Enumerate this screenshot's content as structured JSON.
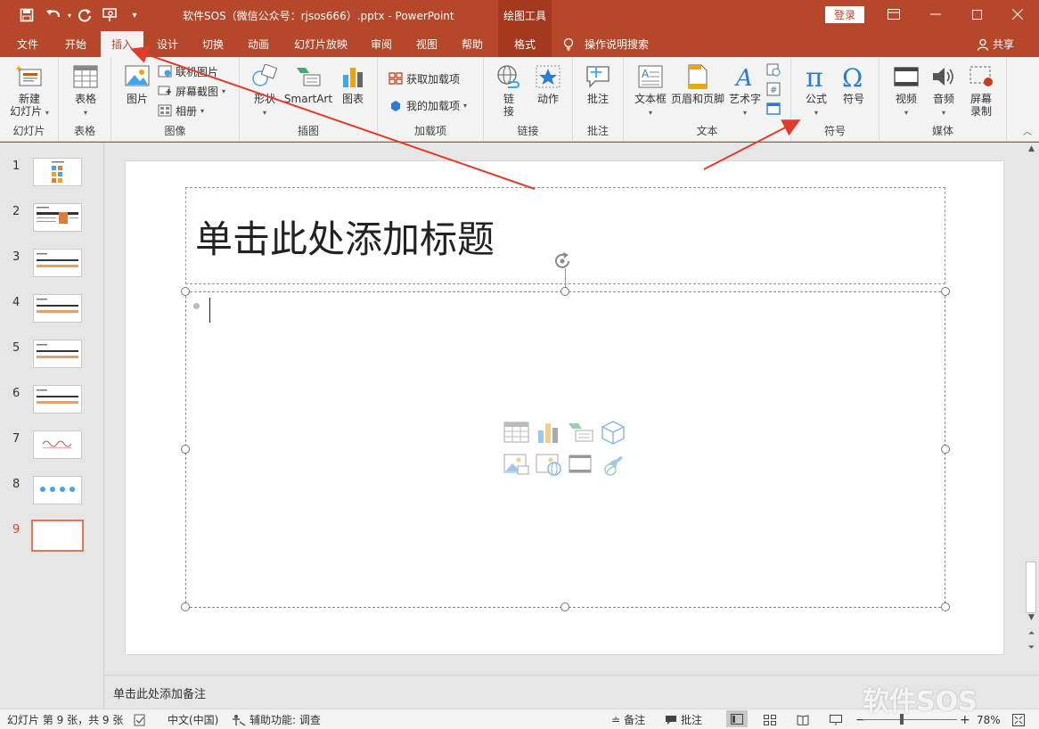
{
  "titlebar": {
    "document_title": "软件SOS（微信公众号：rjsos666）.pptx  -  PowerPoint",
    "context_tools": "绘图工具",
    "login": "登录"
  },
  "tabs": [
    {
      "label": "文件"
    },
    {
      "label": "开始"
    },
    {
      "label": "插入",
      "active": true
    },
    {
      "label": "设计"
    },
    {
      "label": "切换"
    },
    {
      "label": "动画"
    },
    {
      "label": "幻灯片放映"
    },
    {
      "label": "审阅"
    },
    {
      "label": "视图"
    },
    {
      "label": "帮助"
    },
    {
      "label": "格式"
    }
  ],
  "tell_me": "操作说明搜索",
  "share": "共享",
  "ribbon": {
    "new_slide": "新建\n幻灯片",
    "new_slide_l1": "新建",
    "new_slide_l2": "幻灯片",
    "group_slides": "幻灯片",
    "table": "表格",
    "group_table": "表格",
    "picture": "图片",
    "online_picture": "联机图片",
    "screenshot": "屏幕截图",
    "album": "相册",
    "group_image": "图像",
    "shapes": "形状",
    "smartart": "SmartArt",
    "chart": "图表",
    "group_illustrations": "插图",
    "get_addins": "获取加载项",
    "my_addins": "我的加载项",
    "group_addins": "加载项",
    "link_l1": "链",
    "link_l2": "接",
    "action": "动作",
    "group_links": "链接",
    "comment": "批注",
    "group_comments": "批注",
    "textbox": "文本框",
    "header_footer": "页眉和页脚",
    "wordart": "艺术字",
    "group_text": "文本",
    "equation": "公式",
    "symbol": "符号",
    "group_symbols": "符号",
    "video": "视频",
    "audio": "音频",
    "screen_rec_l1": "屏幕",
    "screen_rec_l2": "录制",
    "group_media": "媒体"
  },
  "slides": [
    {
      "num": "1"
    },
    {
      "num": "2"
    },
    {
      "num": "3"
    },
    {
      "num": "4"
    },
    {
      "num": "5"
    },
    {
      "num": "6"
    },
    {
      "num": "7"
    },
    {
      "num": "8"
    },
    {
      "num": "9",
      "active": true
    }
  ],
  "slide": {
    "title_placeholder": "单击此处添加标题"
  },
  "notes_placeholder": "单击此处添加备注",
  "statusbar": {
    "slide_info": "幻灯片 第 9 张，共 9 张",
    "language": "中文(中国)",
    "accessibility": "辅助功能: 调查",
    "notes": "备注",
    "comments": "批注",
    "zoom": "78%",
    "zoom_level": 0.78
  },
  "watermark": "软件SOS",
  "colors": {
    "accent": "#b7472a",
    "active_slide_border": "#e8754f",
    "annotation_arrow": "#e03c2c"
  }
}
